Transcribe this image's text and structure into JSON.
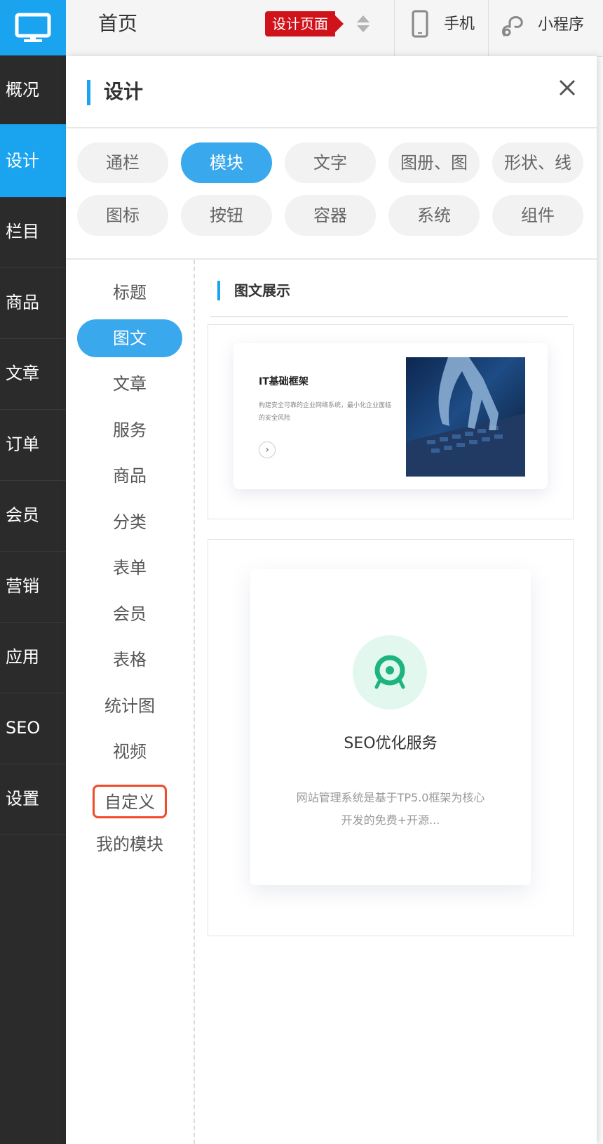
{
  "sidebar": {
    "items": [
      {
        "label": "概况"
      },
      {
        "label": "设计"
      },
      {
        "label": "栏目"
      },
      {
        "label": "商品"
      },
      {
        "label": "文章"
      },
      {
        "label": "订单"
      },
      {
        "label": "会员"
      },
      {
        "label": "营销"
      },
      {
        "label": "应用"
      },
      {
        "label": "SEO"
      },
      {
        "label": "设置"
      }
    ],
    "active_index": 1,
    "accent_color": "#1aa3ef"
  },
  "topbar": {
    "page_title": "首页",
    "badge": "设计页面",
    "phone_label": "手机",
    "mini_program_label": "小程序"
  },
  "panel": {
    "title": "设计",
    "tabs": [
      {
        "label": "通栏"
      },
      {
        "label": "模块"
      },
      {
        "label": "文字"
      },
      {
        "label": "图册、图"
      },
      {
        "label": "形状、线"
      },
      {
        "label": "图标"
      },
      {
        "label": "按钮"
      },
      {
        "label": "容器"
      },
      {
        "label": "系统"
      },
      {
        "label": "组件"
      }
    ],
    "active_tab": 1,
    "subnav": [
      {
        "label": "标题"
      },
      {
        "label": "图文"
      },
      {
        "label": "文章"
      },
      {
        "label": "服务"
      },
      {
        "label": "商品"
      },
      {
        "label": "分类"
      },
      {
        "label": "表单"
      },
      {
        "label": "会员"
      },
      {
        "label": "表格"
      },
      {
        "label": "统计图"
      },
      {
        "label": "视频"
      },
      {
        "label": "自定义"
      },
      {
        "label": "我的模块"
      }
    ],
    "active_subnav": 1,
    "highlighted_subnav": 11,
    "content_title": "图文展示",
    "card1": {
      "title": "IT基础框架",
      "desc": "构建安全可靠的企业网络系统，最小化企业面临的安全风险",
      "arrow": "›"
    },
    "card2": {
      "title": "SEO优化服务",
      "desc": "网站管理系统是基于TP5.0框架为核心开发的免费+开源..."
    }
  }
}
